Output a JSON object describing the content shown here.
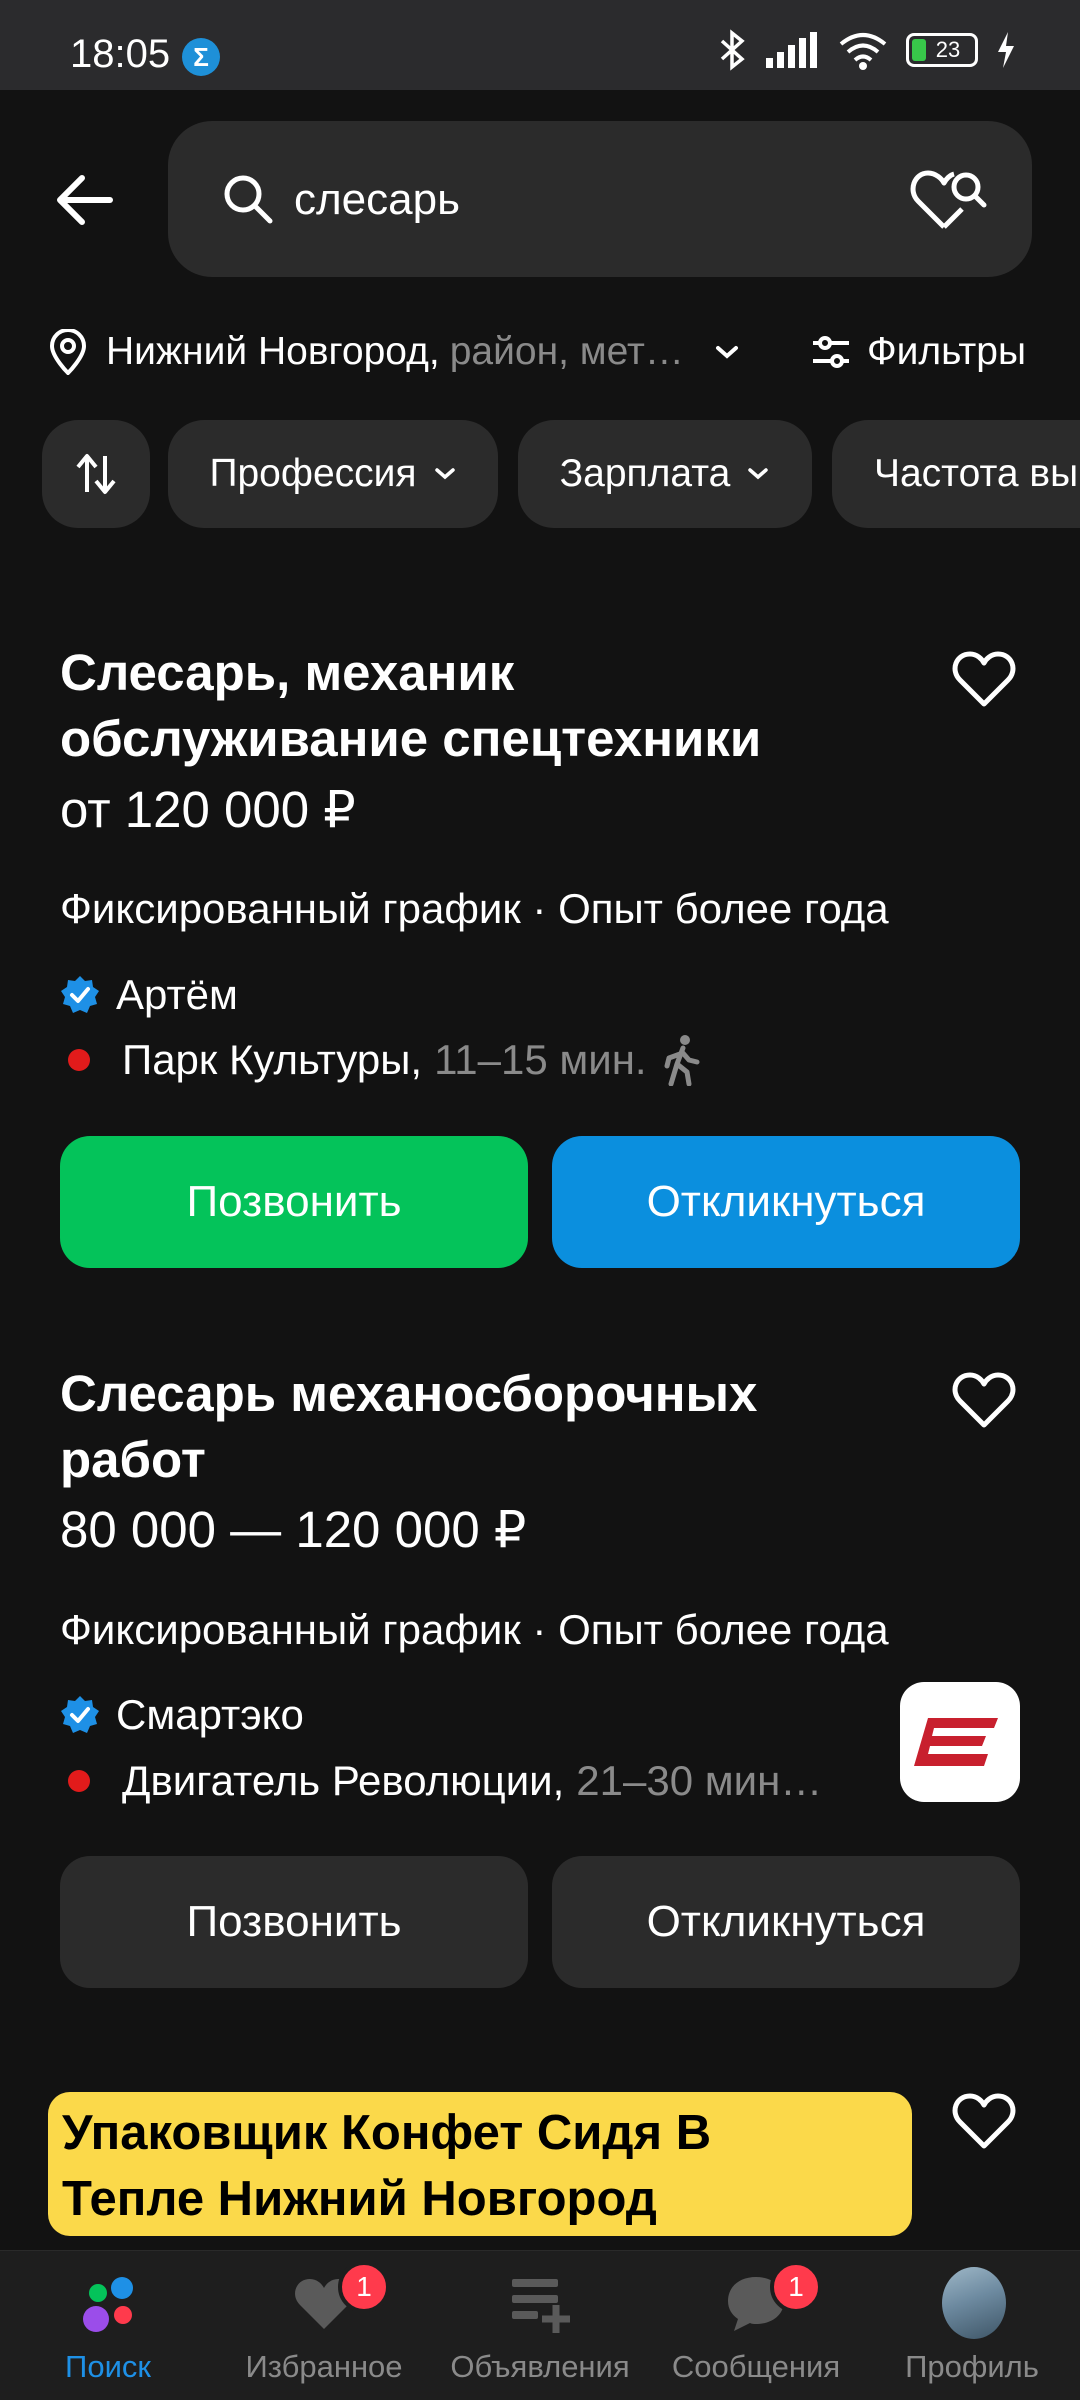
{
  "status_bar": {
    "time": "18:05",
    "battery": "23",
    "app_badge": "Σ"
  },
  "search": {
    "query": "слесарь"
  },
  "location": {
    "city": "Нижний Новгород,",
    "hint": "район, мет…"
  },
  "filters_label": "Фильтры",
  "chips": [
    "Профессия",
    "Зарплата",
    "Частота вы"
  ],
  "cards": [
    {
      "title_line1": "Слесарь, механик",
      "title_line2": "обслуживание спецтехники",
      "salary": "от 120 000 ₽",
      "meta": "Фиксированный график · Опыт более года",
      "company": "Артём",
      "metro": "Парк Культуры,",
      "time": "11–15 мин.",
      "call": "Позвонить",
      "reply": "Откликнуться"
    },
    {
      "title_line1": "Слесарь механосборочных",
      "title_line2": "работ",
      "salary": "80 000 — 120 000 ₽",
      "meta": "Фиксированный график · Опыт более года",
      "company": "Смартэко",
      "metro": "Двигатель Революции,",
      "time": "21–30 мин…",
      "call": "Позвонить",
      "reply": "Откликнуться"
    },
    {
      "title_line1": "Упаковщик Конфет Сидя В",
      "title_line2": "Тепле Нижний Новгород"
    }
  ],
  "nav": [
    {
      "label": "Поиск",
      "icon": "search-tab-icon"
    },
    {
      "label": "Избранное",
      "icon": "heart-icon",
      "badge": "1"
    },
    {
      "label": "Объявления",
      "icon": "ads-icon"
    },
    {
      "label": "Сообщения",
      "icon": "chat-icon",
      "badge": "1"
    },
    {
      "label": "Профиль",
      "icon": "avatar"
    }
  ],
  "colors": {
    "accent_green": "#04c35a",
    "accent_blue": "#0b8fde",
    "highlight_yellow": "#fbd94a",
    "badge_red": "#ff3a4c",
    "active_tab": "#1e90e6"
  }
}
